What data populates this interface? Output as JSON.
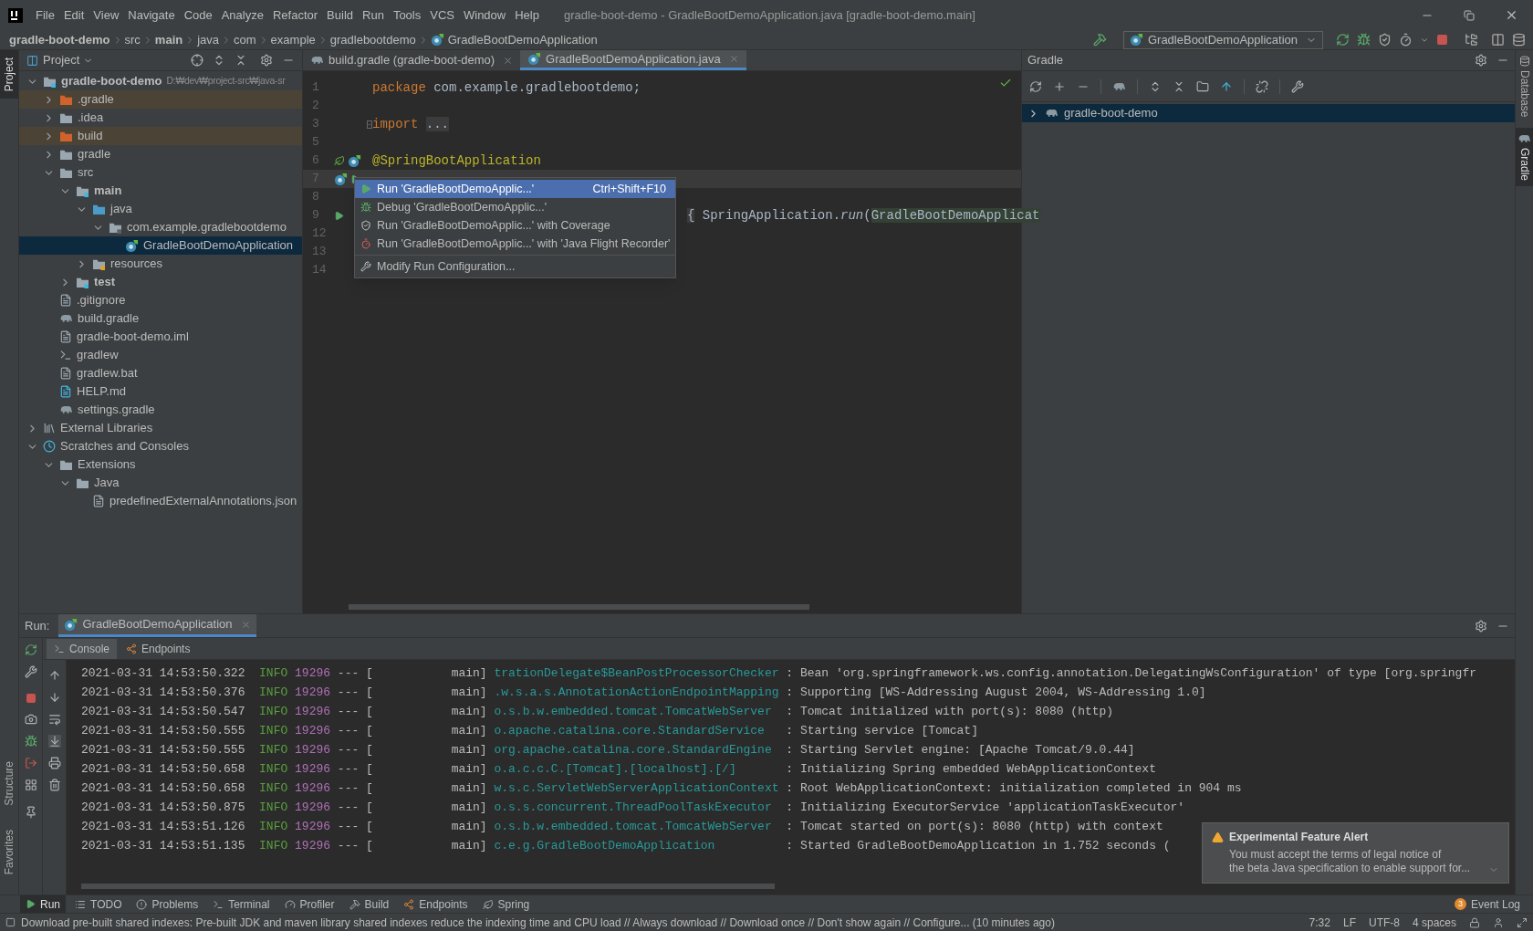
{
  "window": {
    "title": "gradle-boot-demo - GradleBootDemoApplication.java [gradle-boot-demo.main]"
  },
  "menu": [
    "File",
    "Edit",
    "View",
    "Navigate",
    "Code",
    "Analyze",
    "Refactor",
    "Build",
    "Run",
    "Tools",
    "VCS",
    "Window",
    "Help"
  ],
  "breadcrumbs": [
    {
      "label": "gradle-boot-demo",
      "kind": "module"
    },
    {
      "label": "src",
      "kind": "plain"
    },
    {
      "label": "main",
      "kind": "module"
    },
    {
      "label": "java",
      "kind": "plain"
    },
    {
      "label": "com",
      "kind": "plain"
    },
    {
      "label": "example",
      "kind": "plain"
    },
    {
      "label": "gradlebootdemo",
      "kind": "plain"
    },
    {
      "label": "GradleBootDemoApplication",
      "kind": "class"
    }
  ],
  "run_configuration": "GradleBootDemoApplication",
  "left_strip": {
    "top": [
      {
        "label": "Project",
        "selected": true
      }
    ],
    "bottom": [
      {
        "label": "Structure",
        "selected": false
      },
      {
        "label": "Favorites",
        "selected": false
      }
    ]
  },
  "right_strip": [
    {
      "label": "Database",
      "selected": false
    },
    {
      "label": "Gradle",
      "selected": true
    }
  ],
  "project": {
    "title": "Project",
    "tree": [
      {
        "label": "gradle-boot-demo",
        "hint": "D:₩dev₩project-src₩java-sr",
        "kind": "module",
        "expanded": true,
        "selected": false,
        "children": [
          {
            "label": ".gradle",
            "kind": "excluded",
            "expanded": false,
            "selected": false
          },
          {
            "label": ".idea",
            "kind": "folder",
            "expanded": false,
            "selected": false
          },
          {
            "label": "build",
            "kind": "excluded",
            "expanded": false,
            "selected": false
          },
          {
            "label": "gradle",
            "kind": "folder",
            "expanded": false,
            "selected": false
          },
          {
            "label": "src",
            "kind": "folder",
            "expanded": true,
            "selected": false,
            "children": [
              {
                "label": "main",
                "kind": "source",
                "expanded": true,
                "selected": false,
                "children": [
                  {
                    "label": "java",
                    "kind": "java",
                    "expanded": true,
                    "selected": false,
                    "children": [
                      {
                        "label": "com.example.gradlebootdemo",
                        "kind": "package",
                        "expanded": true,
                        "selected": false,
                        "children": [
                          {
                            "label": "GradleBootDemoApplication",
                            "kind": "class",
                            "selected": true
                          }
                        ]
                      }
                    ]
                  },
                  {
                    "label": "resources",
                    "kind": "resources",
                    "expanded": false,
                    "selected": false
                  }
                ]
              },
              {
                "label": "test",
                "kind": "source",
                "expanded": false,
                "selected": false
              }
            ]
          },
          {
            "label": ".gitignore",
            "kind": "file",
            "selected": false
          },
          {
            "label": "build.gradle",
            "kind": "gradle",
            "selected": false
          },
          {
            "label": "gradle-boot-demo.iml",
            "kind": "file",
            "selected": false
          },
          {
            "label": "gradlew",
            "kind": "shell",
            "selected": false
          },
          {
            "label": "gradlew.bat",
            "kind": "file",
            "selected": false
          },
          {
            "label": "HELP.md",
            "kind": "markdown",
            "selected": false
          },
          {
            "label": "settings.gradle",
            "kind": "gradle",
            "selected": false
          }
        ]
      },
      {
        "label": "External Libraries",
        "kind": "libraries",
        "expanded": false,
        "selected": false
      },
      {
        "label": "Scratches and Consoles",
        "kind": "scratches",
        "expanded": true,
        "selected": false,
        "children": [
          {
            "label": "Extensions",
            "kind": "folder",
            "expanded": true,
            "selected": false,
            "children": [
              {
                "label": "Java",
                "kind": "folder",
                "expanded": true,
                "selected": false,
                "children": [
                  {
                    "label": "predefinedExternalAnnotations.json",
                    "kind": "file",
                    "selected": false
                  }
                ]
              }
            ]
          }
        ]
      }
    ]
  },
  "editor": {
    "tabs": [
      {
        "label": "build.gradle (gradle-boot-demo)",
        "kind": "gradle",
        "selected": false
      },
      {
        "label": "GradleBootDemoApplication.java",
        "kind": "class",
        "selected": true
      }
    ],
    "lines": [
      {
        "number": "1",
        "current": false,
        "tokens": [
          {
            "text": "package",
            "kind": "keyword"
          },
          {
            "text": " com.example.gradlebootdemo;",
            "kind": "plain"
          }
        ]
      },
      {
        "number": "2",
        "current": false
      },
      {
        "number": "3",
        "current": false,
        "folded": true,
        "tokens": [
          {
            "text": "import ",
            "kind": "keyword"
          },
          {
            "text": "...",
            "kind": "fold"
          }
        ]
      },
      {
        "number": "5",
        "current": false
      },
      {
        "number": "6",
        "current": false,
        "gutter": [
          {
            "kind": "bean"
          },
          {
            "kind": "spring"
          }
        ],
        "tokens": [
          {
            "text": "@SpringBootApplication",
            "kind": "annotation"
          }
        ]
      },
      {
        "number": "7",
        "current": true,
        "gutter": [
          {
            "kind": "spring"
          },
          {
            "kind": "run"
          }
        ]
      },
      {
        "number": "8",
        "current": false
      },
      {
        "number": "9",
        "current": false,
        "covered": true,
        "gutter": [
          {
            "kind": "run"
          }
        ],
        "tokens": [
          {
            "text": "{",
            "kind": "brace"
          },
          {
            "text": " SpringApplication.",
            "kind": "plain"
          },
          {
            "text": "run",
            "kind": "method"
          },
          {
            "text": "(",
            "kind": "plain"
          },
          {
            "text": "GradleBootDemoApplicat",
            "kind": "usage"
          }
        ]
      },
      {
        "number": "12",
        "current": false
      },
      {
        "number": "13",
        "current": false
      },
      {
        "number": "14",
        "current": false
      }
    ],
    "popup": [
      {
        "label": "Run 'GradleBootDemoApplic...'",
        "shortcut": "Ctrl+Shift+F10",
        "kind": "run",
        "selected": true
      },
      {
        "label": "Debug 'GradleBootDemoApplic...'",
        "kind": "debug",
        "selected": false
      },
      {
        "label": "Run 'GradleBootDemoApplic...' with Coverage",
        "kind": "coverage",
        "selected": false
      },
      {
        "label": "Run 'GradleBootDemoApplic...' with 'Java Flight Recorder'",
        "kind": "recorder",
        "selected": false
      },
      {
        "label": "Modify Run Configuration...",
        "kind": "modify",
        "selected": false,
        "separator_before": true
      }
    ]
  },
  "gradle": {
    "title": "Gradle",
    "tree": [
      {
        "label": "gradle-boot-demo",
        "expanded": false,
        "selected": true
      }
    ]
  },
  "run": {
    "label": "Run:",
    "tab": "GradleBootDemoApplication",
    "subtabs": [
      {
        "label": "Console",
        "kind": "console",
        "selected": true
      },
      {
        "label": "Endpoints",
        "kind": "endpoints",
        "selected": false
      }
    ],
    "log": [
      {
        "timestamp": "2021-03-31 14:53:50.322",
        "level": "INFO",
        "pid": "19296",
        "thread": "--- [           main]",
        "logger": "trationDelegate$BeanPostProcessorChecker",
        "message": ": Bean 'org.springframework.ws.config.annotation.DelegatingWsConfiguration' of type [org.springfr"
      },
      {
        "timestamp": "2021-03-31 14:53:50.376",
        "level": "INFO",
        "pid": "19296",
        "thread": "--- [           main]",
        "logger": ".w.s.a.s.AnnotationActionEndpointMapping",
        "message": ": Supporting [WS-Addressing August 2004, WS-Addressing 1.0]"
      },
      {
        "timestamp": "2021-03-31 14:53:50.547",
        "level": "INFO",
        "pid": "19296",
        "thread": "--- [           main]",
        "logger": "o.s.b.w.embedded.tomcat.TomcatWebServer",
        "message": ": Tomcat initialized with port(s): 8080 (http)"
      },
      {
        "timestamp": "2021-03-31 14:53:50.555",
        "level": "INFO",
        "pid": "19296",
        "thread": "--- [           main]",
        "logger": "o.apache.catalina.core.StandardService",
        "message": ": Starting service [Tomcat]"
      },
      {
        "timestamp": "2021-03-31 14:53:50.555",
        "level": "INFO",
        "pid": "19296",
        "thread": "--- [           main]",
        "logger": "org.apache.catalina.core.StandardEngine",
        "message": ": Starting Servlet engine: [Apache Tomcat/9.0.44]"
      },
      {
        "timestamp": "2021-03-31 14:53:50.658",
        "level": "INFO",
        "pid": "19296",
        "thread": "--- [           main]",
        "logger": "o.a.c.c.C.[Tomcat].[localhost].[/]",
        "message": ": Initializing Spring embedded WebApplicationContext"
      },
      {
        "timestamp": "2021-03-31 14:53:50.658",
        "level": "INFO",
        "pid": "19296",
        "thread": "--- [           main]",
        "logger": "w.s.c.ServletWebServerApplicationContext",
        "message": ": Root WebApplicationContext: initialization completed in 904 ms"
      },
      {
        "timestamp": "2021-03-31 14:53:50.875",
        "level": "INFO",
        "pid": "19296",
        "thread": "--- [           main]",
        "logger": "o.s.s.concurrent.ThreadPoolTaskExecutor",
        "message": ": Initializing ExecutorService 'applicationTaskExecutor'"
      },
      {
        "timestamp": "2021-03-31 14:53:51.126",
        "level": "INFO",
        "pid": "19296",
        "thread": "--- [           main]",
        "logger": "o.s.b.w.embedded.tomcat.TomcatWebServer",
        "message": ": Tomcat started on port(s): 8080 (http) with context"
      },
      {
        "timestamp": "2021-03-31 14:53:51.135",
        "level": "INFO",
        "pid": "19296",
        "thread": "--- [           main]",
        "logger": "c.e.g.GradleBootDemoApplication",
        "message": ": Started GradleBootDemoApplication in 1.752 seconds ("
      }
    ]
  },
  "notification": {
    "title": "Experimental Feature Alert",
    "body": [
      "You must accept the terms of legal notice of",
      "the beta Java specification to enable support for..."
    ]
  },
  "tool_windows": [
    {
      "label": "Run",
      "kind": "run",
      "selected": true
    },
    {
      "label": "TODO",
      "kind": "todo",
      "selected": false
    },
    {
      "label": "Problems",
      "kind": "problems",
      "selected": false
    },
    {
      "label": "Terminal",
      "kind": "terminal",
      "selected": false
    },
    {
      "label": "Profiler",
      "kind": "profiler",
      "selected": false
    },
    {
      "label": "Build",
      "kind": "build",
      "selected": false
    },
    {
      "label": "Endpoints",
      "kind": "endpoints",
      "selected": false
    },
    {
      "label": "Spring",
      "kind": "spring",
      "selected": false
    }
  ],
  "event_log": {
    "label": "Event Log",
    "count": "3"
  },
  "status_bar": {
    "message": "Download pre-built shared indexes: Pre-built JDK and maven library shared indexes reduce the indexing time and CPU load // Always download // Download once // Don't show again // Configure... (10 minutes ago)",
    "items": [
      "7:32",
      "LF",
      "UTF-8",
      "4 spaces"
    ]
  }
}
